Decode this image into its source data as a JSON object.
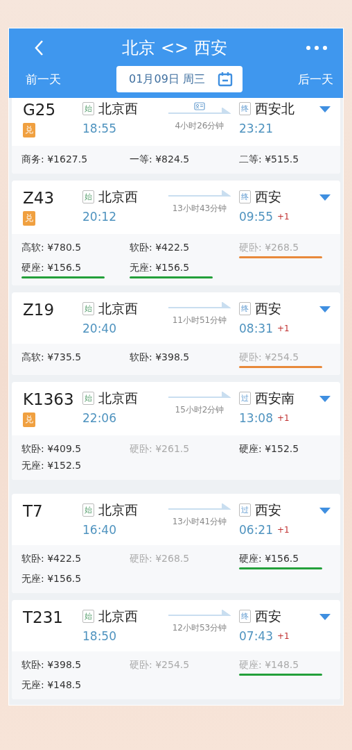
{
  "header": {
    "title": "北京 <> 西安",
    "prev_day": "前一天",
    "date": "01月09日 周三",
    "next_day": "后一天"
  },
  "trains": [
    {
      "number": "G25",
      "redeem": true,
      "redeem_label": "兑",
      "from_tag": "始",
      "from": "北京西",
      "depart": "18:55",
      "id_card": true,
      "duration": "4小时26分钟",
      "to_tag": "终",
      "to": "西安北",
      "arrive": "23:21",
      "fares": [
        {
          "label": "商务: ¥1627.5",
          "available": true
        },
        {
          "label": "一等: ¥824.5",
          "available": true
        },
        {
          "label": "二等: ¥515.5",
          "available": true
        }
      ]
    },
    {
      "number": "Z43",
      "redeem": true,
      "redeem_label": "兑",
      "from_tag": "始",
      "from": "北京西",
      "depart": "20:12",
      "id_card": false,
      "duration": "13小时43分钟",
      "to_tag": "终",
      "to": "西安",
      "arrive": "09:55",
      "plus": "+1",
      "fares": [
        {
          "label": "高软: ¥780.5",
          "available": true
        },
        {
          "label": "软卧: ¥422.5",
          "available": true
        },
        {
          "label": "硬卧: ¥268.5",
          "available": false,
          "color": "#e8893a"
        },
        {
          "label": "硬座: ¥156.5",
          "available": true,
          "color": "#23a03a"
        },
        {
          "label": "无座: ¥156.5",
          "available": true,
          "color": "#23a03a"
        }
      ]
    },
    {
      "number": "Z19",
      "redeem": false,
      "from_tag": "始",
      "from": "北京西",
      "depart": "20:40",
      "id_card": false,
      "duration": "11小时51分钟",
      "to_tag": "终",
      "to": "西安",
      "arrive": "08:31",
      "plus": "+1",
      "fares": [
        {
          "label": "高软: ¥735.5",
          "available": true
        },
        {
          "label": "软卧: ¥398.5",
          "available": true
        },
        {
          "label": "硬卧: ¥254.5",
          "available": false,
          "color": "#e8893a"
        }
      ]
    },
    {
      "number": "K1363",
      "redeem": true,
      "redeem_label": "兑",
      "from_tag": "始",
      "from": "北京西",
      "depart": "22:06",
      "id_card": false,
      "duration": "15小时2分钟",
      "to_tag": "过",
      "to": "西安南",
      "arrive": "13:08",
      "plus": "+1",
      "fares": [
        {
          "label": "软卧: ¥409.5",
          "available": true
        },
        {
          "label": "硬卧: ¥261.5",
          "available": false
        },
        {
          "label": "硬座: ¥152.5",
          "available": true
        },
        {
          "label": "无座: ¥152.5",
          "available": true
        }
      ]
    },
    {
      "number": "T7",
      "redeem": false,
      "from_tag": "始",
      "from": "北京西",
      "depart": "16:40",
      "id_card": false,
      "duration": "13小时41分钟",
      "to_tag": "过",
      "to": "西安",
      "arrive": "06:21",
      "plus": "+1",
      "fares": [
        {
          "label": "软卧: ¥422.5",
          "available": true
        },
        {
          "label": "硬卧: ¥268.5",
          "available": false
        },
        {
          "label": "硬座: ¥156.5",
          "available": true,
          "color": "#23a03a"
        },
        {
          "label": "无座: ¥156.5",
          "available": true
        }
      ]
    },
    {
      "number": "T231",
      "redeem": false,
      "from_tag": "始",
      "from": "北京西",
      "depart": "18:50",
      "id_card": false,
      "duration": "12小时53分钟",
      "to_tag": "终",
      "to": "西安",
      "arrive": "07:43",
      "plus": "+1",
      "fares": [
        {
          "label": "软卧: ¥398.5",
          "available": true
        },
        {
          "label": "硬卧: ¥254.5",
          "available": false
        },
        {
          "label": "硬座: ¥148.5",
          "available": false,
          "color": "#23a03a"
        },
        {
          "label": "无座: ¥148.5",
          "available": true
        }
      ]
    }
  ]
}
